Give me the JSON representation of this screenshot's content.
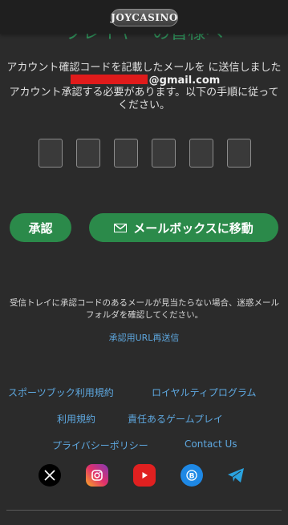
{
  "header": {
    "logo_text": "JOYCASINO"
  },
  "page": {
    "title_partial": "プレイヤーの皆様へ"
  },
  "intro": {
    "line1": "アカウント確認コードを記載したメールを に送信しました",
    "email_suffix": "@gmail.com",
    "line3": "アカウント承認する必要があります。以下の手順に従ってください。"
  },
  "code_inputs": [
    "",
    "",
    "",
    "",
    "",
    ""
  ],
  "buttons": {
    "approve_label": "承認",
    "mailbox_label": "メールボックスに移動"
  },
  "hint_text": "受信トレイに承認コードのあるメールが見当たらない場合、迷惑メールフォルダを確認してください。",
  "resend_label": "承認用URL再送信",
  "footer_links": {
    "sportsbook_rules": "スポーツブック利用規約",
    "loyalty_program": "ロイヤルティプログラム",
    "terms": "利用規約",
    "responsible_gaming": "責任あるゲームプレイ",
    "privacy_policy": "プライバシーポリシー",
    "contact_us": "Contact Us"
  },
  "socials": [
    {
      "icon": "x-icon",
      "color": "#000000"
    },
    {
      "icon": "instagram-icon",
      "color": "#c13584"
    },
    {
      "icon": "youtube-icon",
      "color": "#e02020"
    },
    {
      "icon": "b-icon",
      "color": "#1e88e5"
    },
    {
      "icon": "telegram-icon",
      "color": "#2aa3df"
    }
  ]
}
